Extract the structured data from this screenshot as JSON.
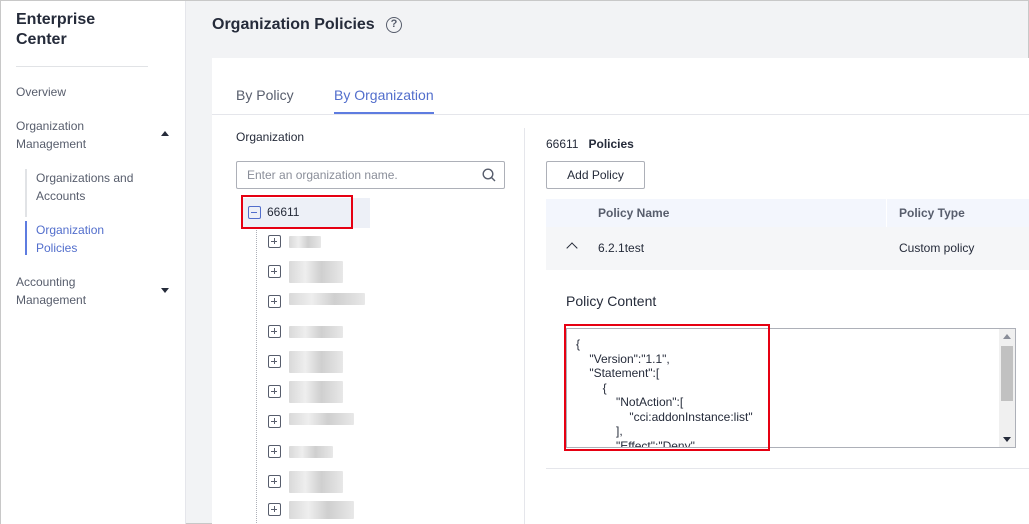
{
  "sidebar": {
    "brand_line1": "Enterprise",
    "brand_line2": "Center",
    "items": {
      "overview": "Overview",
      "org_mgmt_line1": "Organization",
      "org_mgmt_line2": "Management",
      "orgs_accounts_line1": "Organizations and",
      "orgs_accounts_line2": "Accounts",
      "org_policies_line1": "Organization",
      "org_policies_line2": "Policies",
      "accounting_line1": "Accounting",
      "accounting_line2": "Management"
    }
  },
  "header": {
    "title": "Organization Policies",
    "help": "?"
  },
  "tabs": {
    "by_policy": "By Policy",
    "by_org": "By Organization"
  },
  "left_panel": {
    "label": "Organization",
    "search_placeholder": "Enter an organization name.",
    "root_node": "66611"
  },
  "right_panel": {
    "org_id": "66611",
    "heading": "Policies",
    "add_button": "Add Policy",
    "columns": {
      "name": "Policy Name",
      "type": "Policy Type"
    },
    "row": {
      "name": "6.2.1test",
      "type": "Custom policy"
    },
    "content_title": "Policy Content",
    "content_lines": [
      "{",
      "    \"Version\":\"1.1\",",
      "    \"Statement\":[",
      "        {",
      "            \"NotAction\":[",
      "                \"cci:addonInstance:list\"",
      "            ],",
      "            \"Effect\":\"Deny\""
    ]
  },
  "colors": {
    "accent": "#526ecc",
    "highlight": "#e60012"
  }
}
